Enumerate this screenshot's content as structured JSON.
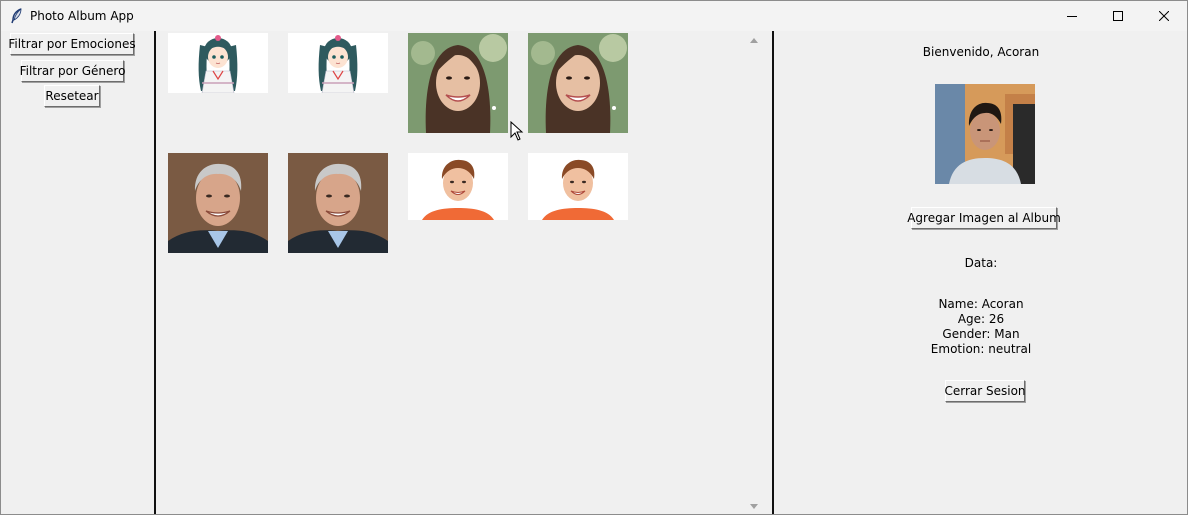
{
  "window": {
    "title": "Photo Album App"
  },
  "sidebar": {
    "filter_emotions_label": "Filtrar por Emociones",
    "filter_gender_label": "Filtrar por Género",
    "reset_label": "Resetear"
  },
  "gallery": {
    "images": [
      {
        "subject": "anime-girl"
      },
      {
        "subject": "anime-girl"
      },
      {
        "subject": "smiling-woman"
      },
      {
        "subject": "smiling-woman"
      },
      {
        "subject": "older-man-in-suit"
      },
      {
        "subject": "older-man-in-suit"
      },
      {
        "subject": "smiling-boy"
      },
      {
        "subject": "smiling-boy"
      }
    ]
  },
  "profile": {
    "welcome": "Bienvenido, Acoran",
    "add_image_label": "Agregar Imagen al Album",
    "data_header": "Data:",
    "name_line": "Name: Acoran",
    "age_line": "Age: 26",
    "gender_line": "Gender: Man",
    "emotion_line": "Emotion: neutral",
    "logout_label": "Cerrar Sesion"
  }
}
